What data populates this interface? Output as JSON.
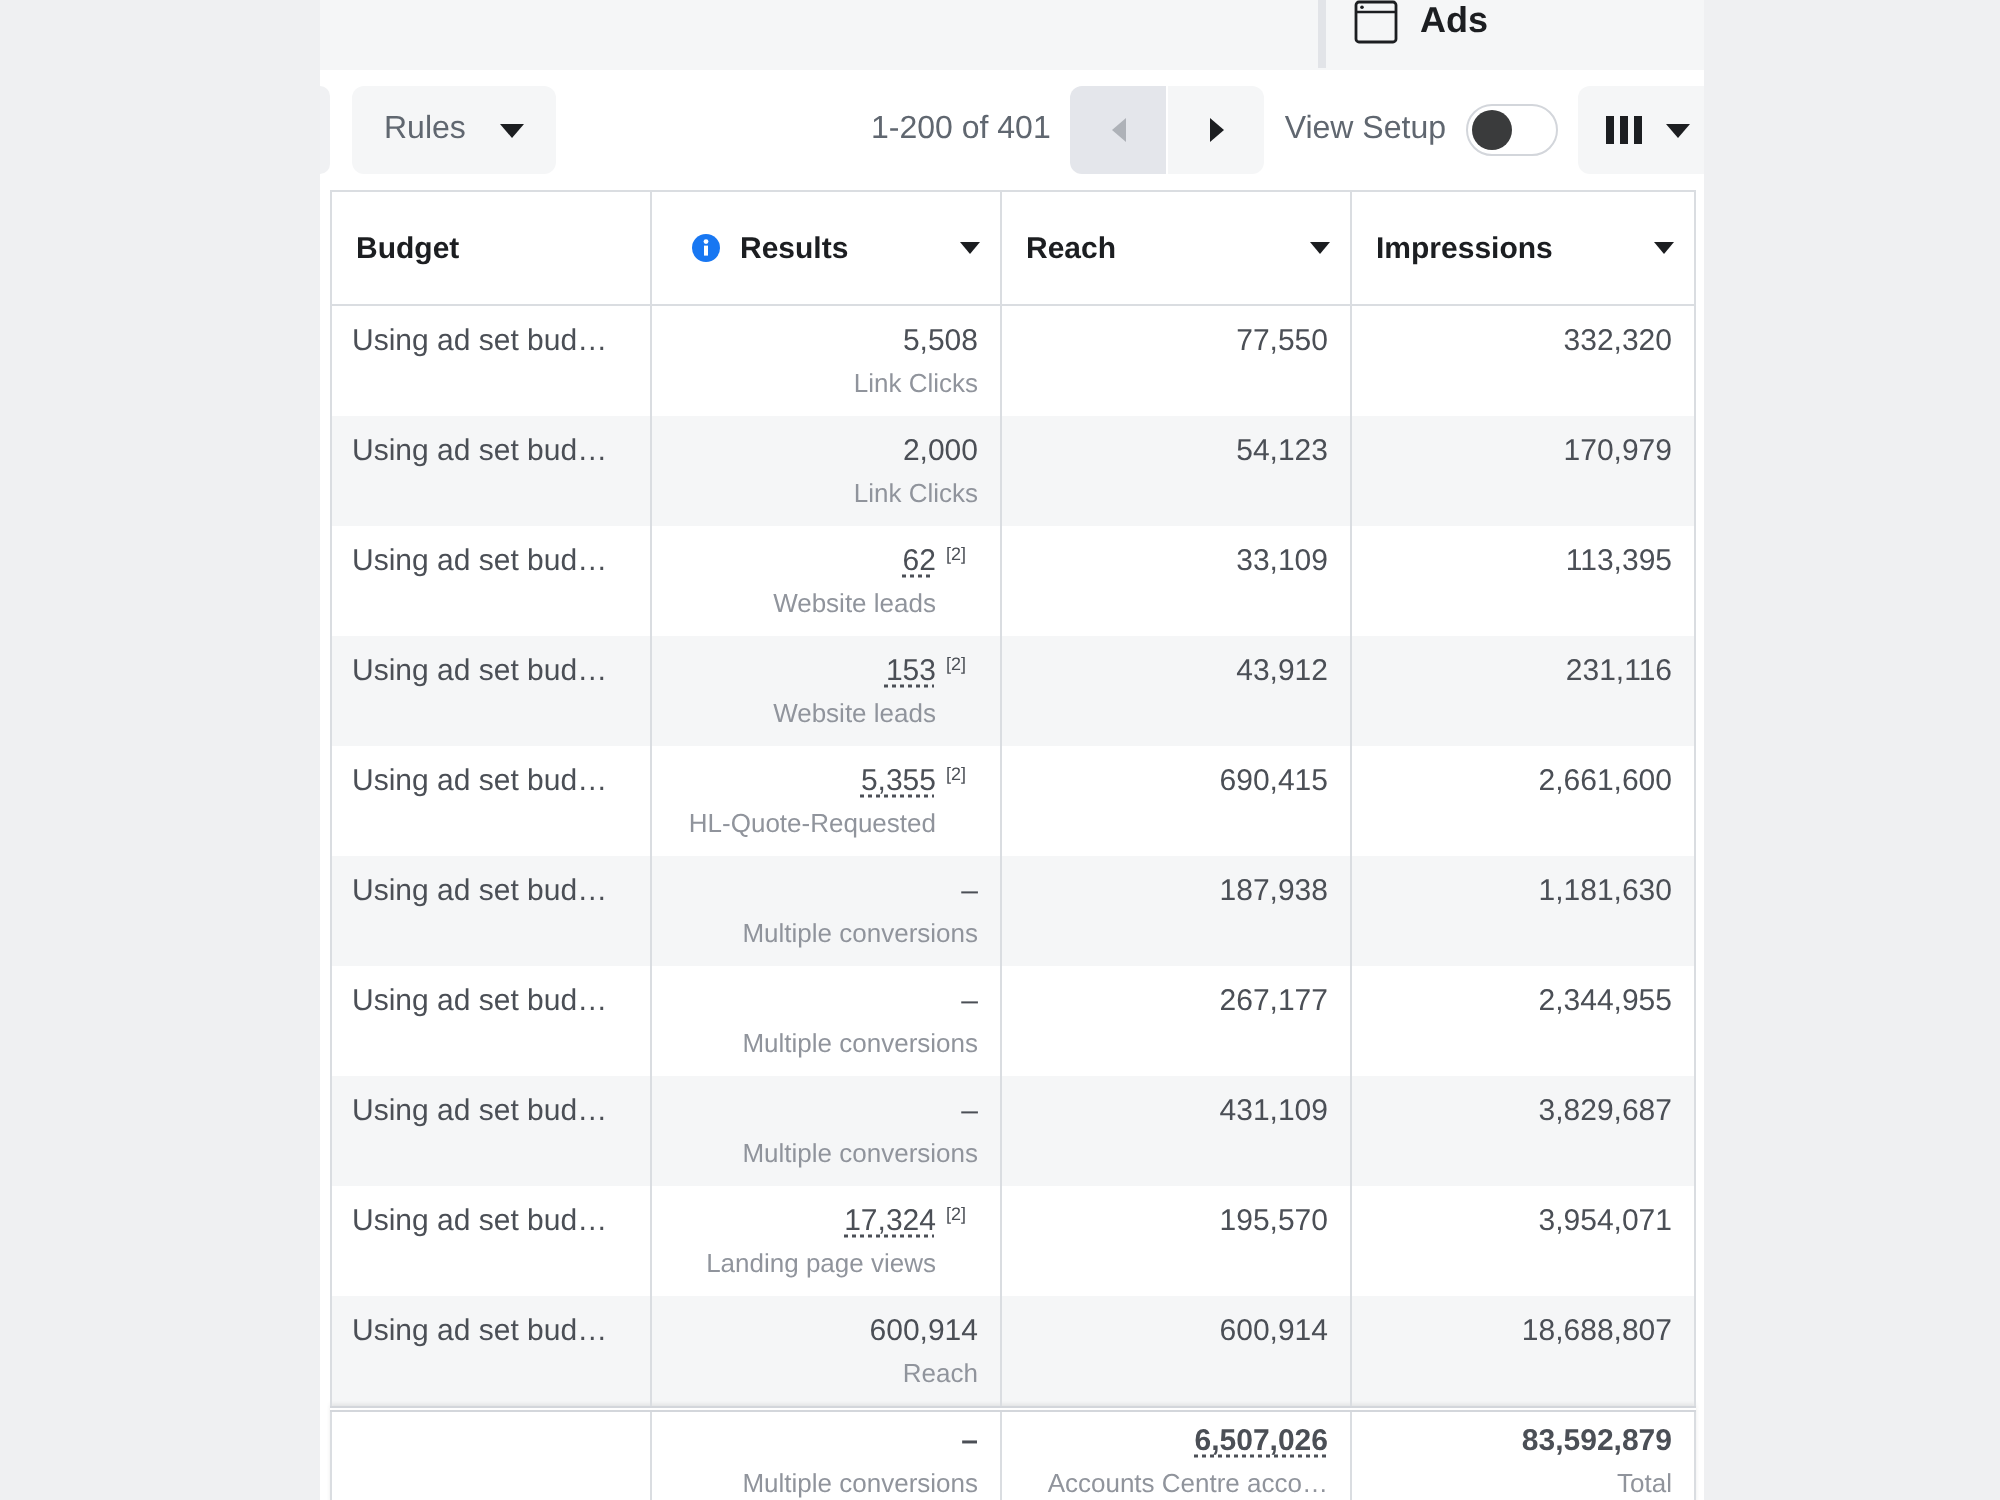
{
  "top_bar": {
    "ads_tab": {
      "label": "Ads"
    }
  },
  "toolbar": {
    "rules_button": {
      "label": "Rules"
    },
    "page_range": "1-200 of 401",
    "pagination": {
      "prev": {
        "disabled": true
      },
      "next": {
        "disabled": false
      }
    },
    "view_setup": {
      "label": "View Setup",
      "on": false
    }
  },
  "table": {
    "columns": [
      {
        "label": "Budget",
        "info": false,
        "menu": false
      },
      {
        "label": "Results",
        "info": true,
        "menu": true
      },
      {
        "label": "Reach",
        "info": false,
        "menu": true
      },
      {
        "label": "Impressions",
        "info": false,
        "menu": true
      }
    ],
    "rows": [
      {
        "budget": "Using ad set bud…",
        "results": {
          "value": "5,508",
          "label": "Link Clicks",
          "underlined": false
        },
        "reach": "77,550",
        "impressions": "332,320"
      },
      {
        "budget": "Using ad set bud…",
        "results": {
          "value": "2,000",
          "label": "Link Clicks",
          "underlined": false
        },
        "reach": "54,123",
        "impressions": "170,979"
      },
      {
        "budget": "Using ad set bud…",
        "results": {
          "value": "62",
          "footnote": "[2]",
          "label": "Website leads",
          "underlined": true
        },
        "reach": "33,109",
        "impressions": "113,395"
      },
      {
        "budget": "Using ad set bud…",
        "results": {
          "value": "153",
          "footnote": "[2]",
          "label": "Website leads",
          "underlined": true
        },
        "reach": "43,912",
        "impressions": "231,116"
      },
      {
        "budget": "Using ad set bud…",
        "results": {
          "value": "5,355",
          "footnote": "[2]",
          "label": "HL-Quote-Requested",
          "underlined": true
        },
        "reach": "690,415",
        "impressions": "2,661,600"
      },
      {
        "budget": "Using ad set bud…",
        "results": {
          "value": "–",
          "label": "Multiple conversions",
          "underlined": false
        },
        "reach": "187,938",
        "impressions": "1,181,630"
      },
      {
        "budget": "Using ad set bud…",
        "results": {
          "value": "–",
          "label": "Multiple conversions",
          "underlined": false
        },
        "reach": "267,177",
        "impressions": "2,344,955"
      },
      {
        "budget": "Using ad set bud…",
        "results": {
          "value": "–",
          "label": "Multiple conversions",
          "underlined": false
        },
        "reach": "431,109",
        "impressions": "3,829,687"
      },
      {
        "budget": "Using ad set bud…",
        "results": {
          "value": "17,324",
          "footnote": "[2]",
          "label": "Landing page views",
          "underlined": true
        },
        "reach": "195,570",
        "impressions": "3,954,071"
      },
      {
        "budget": "Using ad set bud…",
        "results": {
          "value": "600,914",
          "label": "Reach",
          "underlined": false
        },
        "reach": "600,914",
        "impressions": "18,688,807"
      }
    ],
    "totals": {
      "results": {
        "value": "–",
        "label": "Multiple conversions",
        "underlined": false
      },
      "reach": {
        "value": "6,507,026",
        "label": "Accounts Centre acco…",
        "underlined": true
      },
      "impressions": {
        "value": "83,592,879",
        "label": "Total",
        "underlined": false
      }
    }
  }
}
